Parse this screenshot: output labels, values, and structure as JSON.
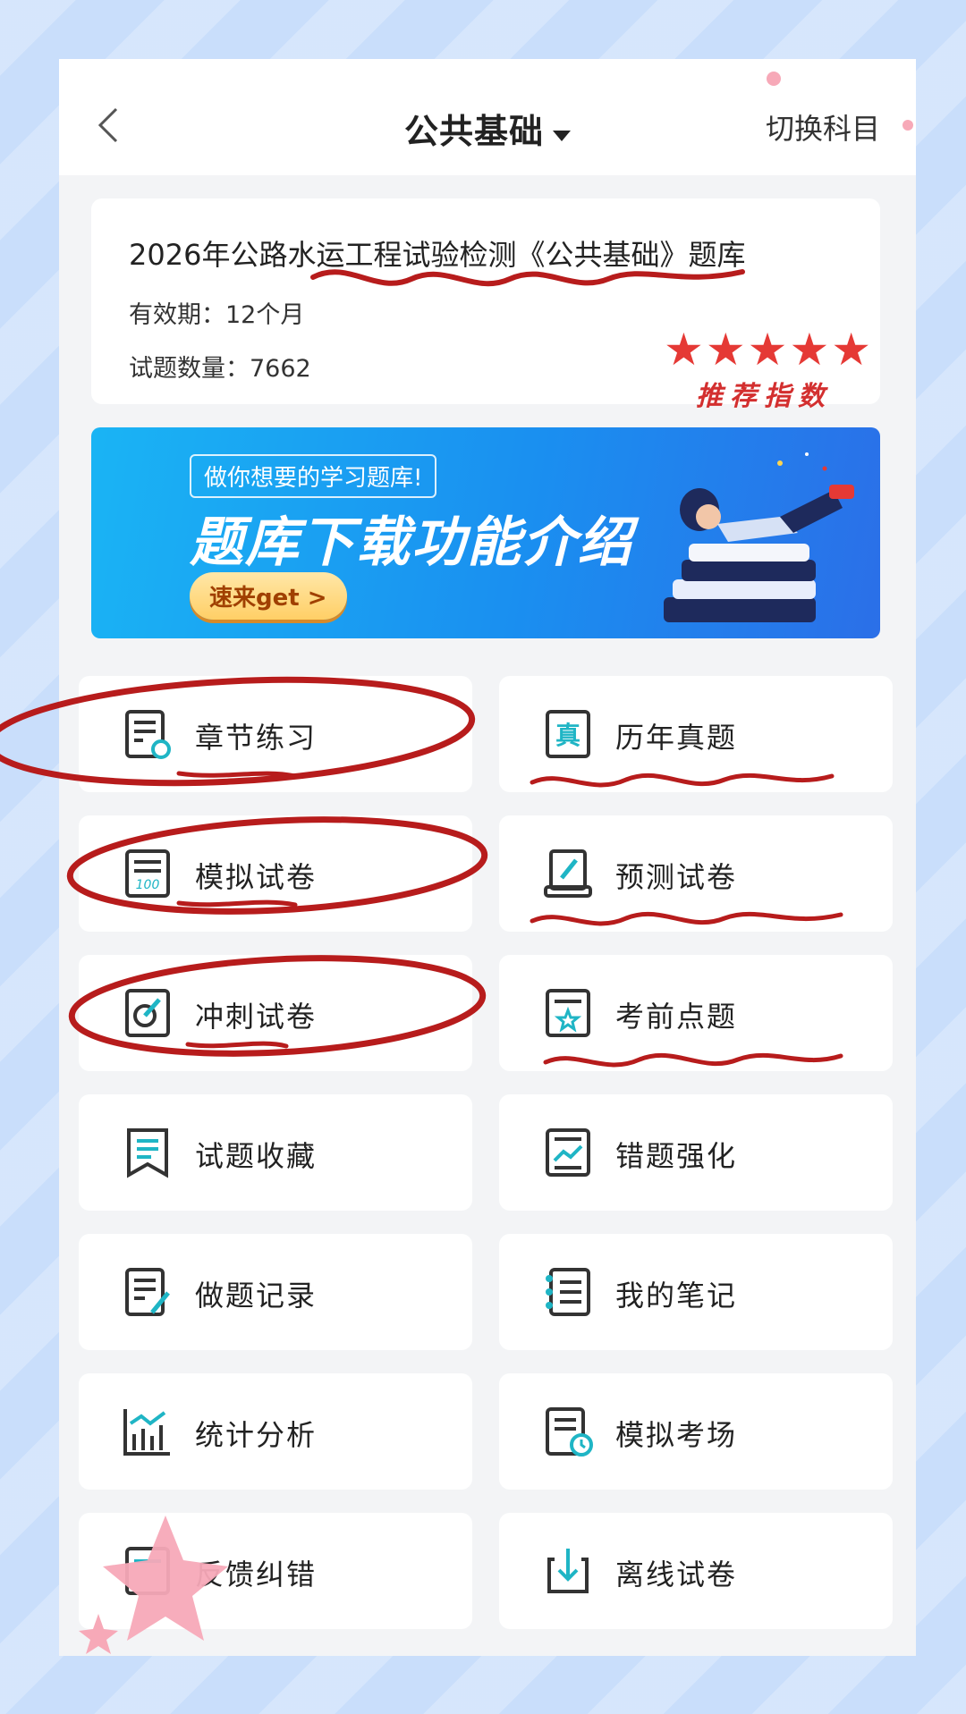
{
  "header": {
    "title": "公共基础",
    "switch_label": "切换科目"
  },
  "info": {
    "title": "2026年公路水运工程试验检测《公共基础》题库",
    "validity": "有效期：12个月",
    "question_count": "试题数量：7662",
    "stars": "★★★★★",
    "recommend_label": "推荐指数"
  },
  "banner": {
    "subtitle": "做你想要的学习题库!",
    "headline": "题库下载功能介绍",
    "button": "速来get >"
  },
  "menu": [
    {
      "label": "章节练习",
      "icon": "chapter-practice-icon"
    },
    {
      "label": "历年真题",
      "icon": "past-exams-icon"
    },
    {
      "label": "模拟试卷",
      "icon": "mock-paper-icon"
    },
    {
      "label": "预测试卷",
      "icon": "forecast-paper-icon"
    },
    {
      "label": "冲刺试卷",
      "icon": "sprint-paper-icon"
    },
    {
      "label": "考前点题",
      "icon": "pre-exam-tips-icon"
    },
    {
      "label": "试题收藏",
      "icon": "bookmark-icon"
    },
    {
      "label": "错题强化",
      "icon": "wrong-questions-icon"
    },
    {
      "label": "做题记录",
      "icon": "record-icon"
    },
    {
      "label": "我的笔记",
      "icon": "notes-icon"
    },
    {
      "label": "统计分析",
      "icon": "statistics-icon"
    },
    {
      "label": "模拟考场",
      "icon": "mock-exam-room-icon"
    },
    {
      "label": "反馈纠错",
      "icon": "feedback-icon"
    },
    {
      "label": "离线试卷",
      "icon": "offline-download-icon"
    }
  ],
  "colors": {
    "accent_teal": "#1fb5c5",
    "annotation_red": "#b71c1c",
    "banner_blue": "#1a8ff0"
  }
}
